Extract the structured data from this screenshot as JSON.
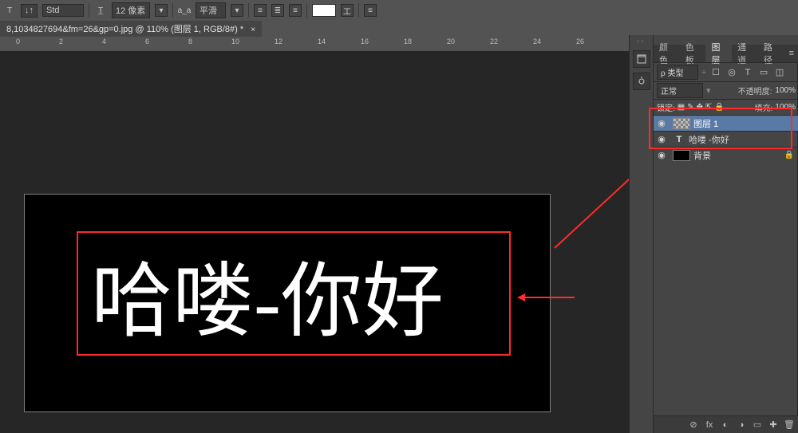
{
  "options": {
    "font_label": "Std",
    "size_icon": "T̲",
    "size_val": "12 像素",
    "aa_label": "a_a",
    "aa_val": "平滑",
    "warp_icon": "工"
  },
  "doc_tab": {
    "title": "8,1034827694&fm=26&gp=0.jpg @ 110% (图层 1, RGB/8#) *"
  },
  "ruler_ticks": [
    "0",
    "2",
    "4",
    "6",
    "8",
    "10",
    "12",
    "14",
    "16",
    "18",
    "20",
    "22",
    "24",
    "26"
  ],
  "canvas": {
    "big_text": "哈喽-你好"
  },
  "panel": {
    "tabs": [
      "颜色",
      "色板",
      "图层",
      "通道",
      "路径"
    ],
    "active_tab": 2,
    "filter_kind": "ρ 类型",
    "filter_icons": [
      "☐",
      "◎",
      "T",
      "▭",
      "◫"
    ],
    "blend_mode": "正常",
    "opacity_label": "不透明度:",
    "opacity_val": "100%",
    "lock_label": "锁定:",
    "lock_icons": [
      "▦",
      "✎",
      "✥",
      "⇱",
      "🔒"
    ],
    "fill_label": "填充:",
    "fill_val": "100%",
    "layers": [
      {
        "type": "raster",
        "name": "图层 1",
        "selected": true,
        "visible": true
      },
      {
        "type": "text",
        "name": "哈喽 -你好",
        "selected": false,
        "visible": true
      },
      {
        "type": "bg",
        "name": "背景",
        "selected": false,
        "visible": true,
        "locked": true
      }
    ],
    "bottom_icons": [
      "⊘",
      "fx",
      "◐",
      "◑",
      "▭",
      "✚",
      "🗑"
    ]
  }
}
